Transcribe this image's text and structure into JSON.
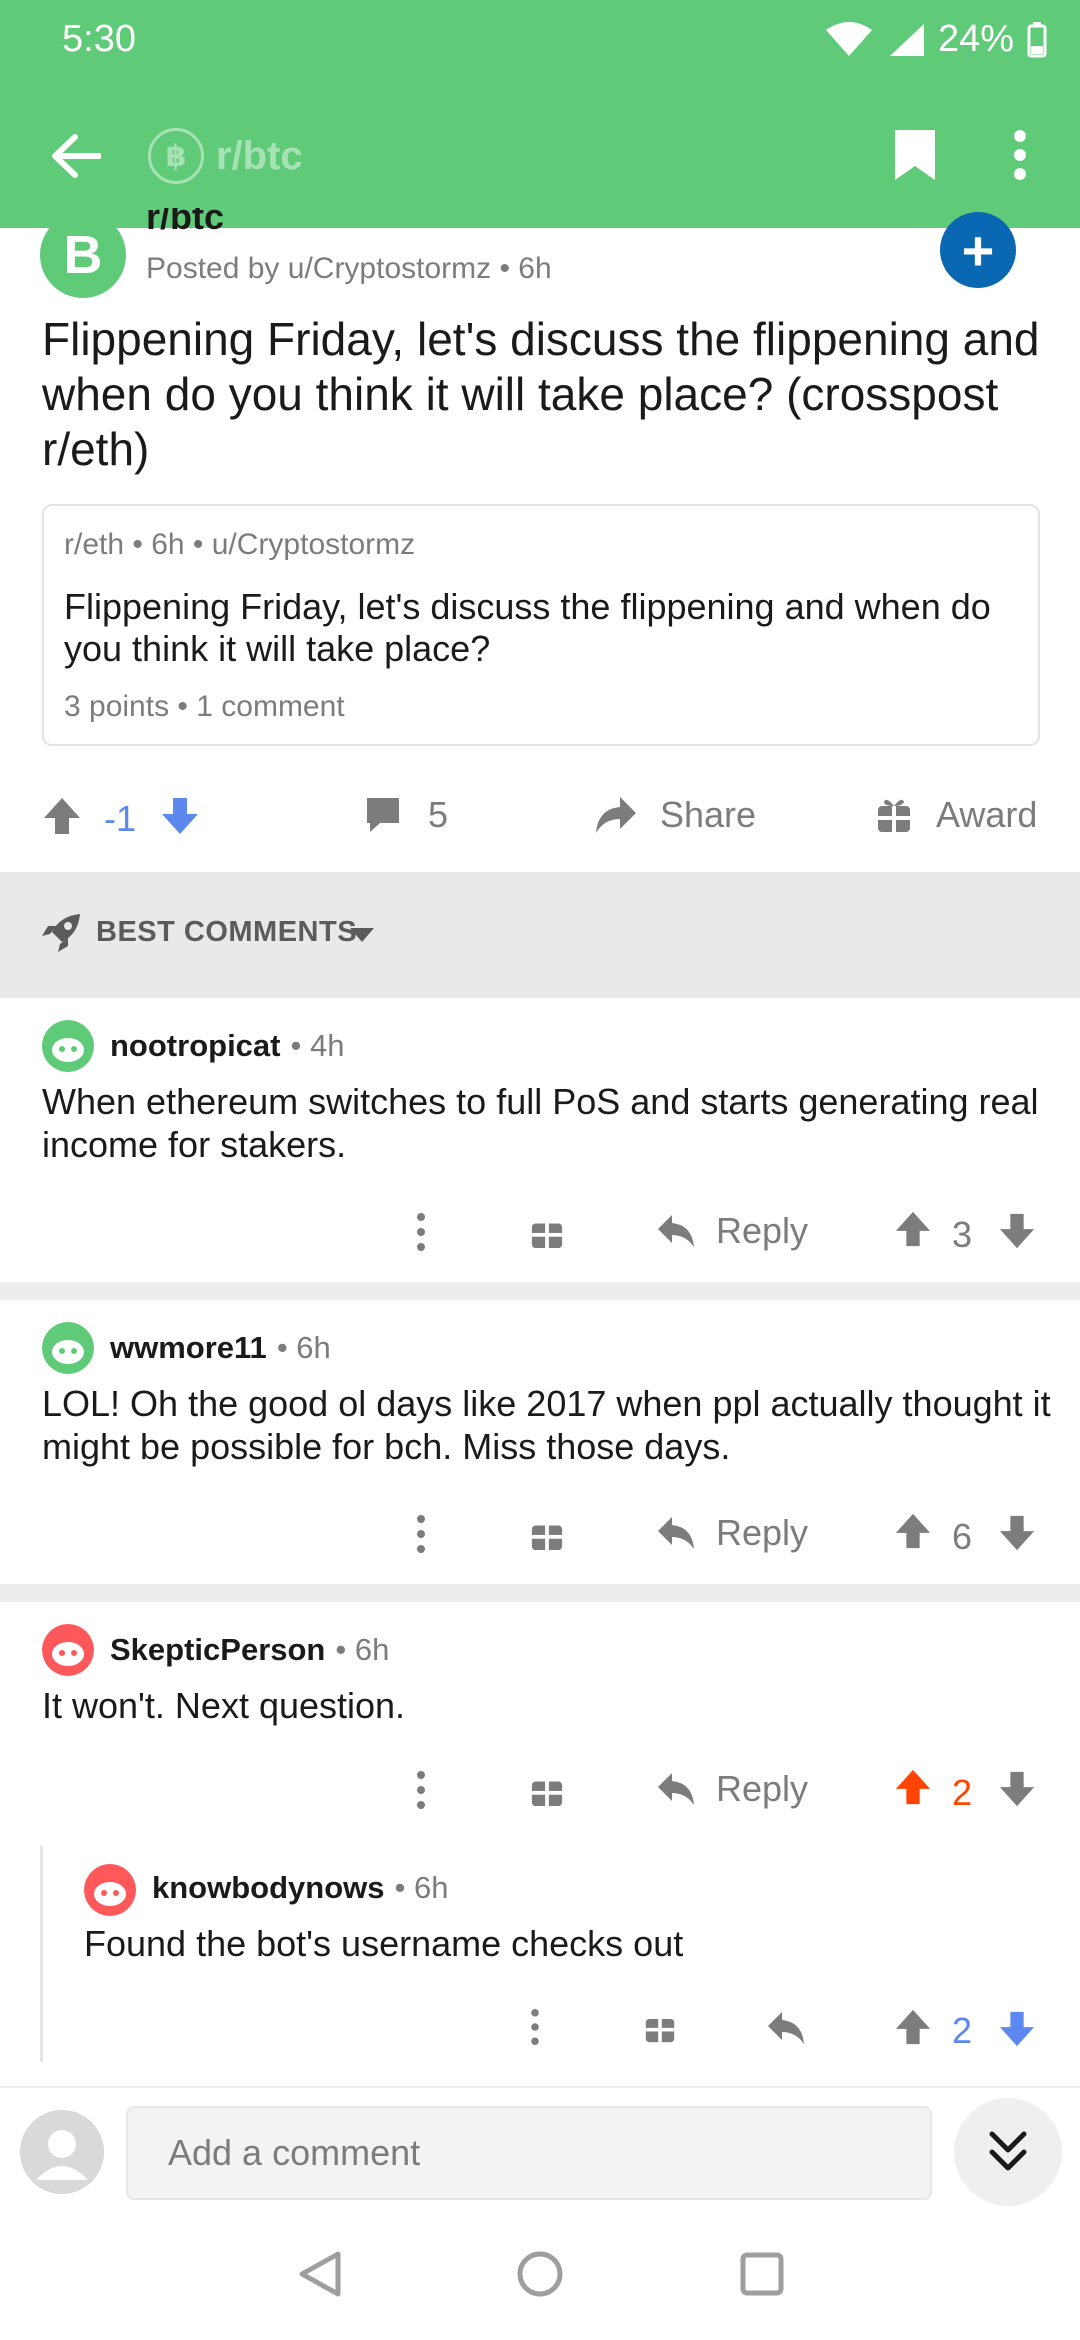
{
  "status": {
    "time": "5:30",
    "battery": "24%"
  },
  "appbar": {
    "subreddit": "r/btc",
    "coin_glyph": "฿"
  },
  "post": {
    "subreddit_avatar_glyph": "B",
    "subreddit": "r/btc",
    "posted_by": "Posted by u/Cryptostormz • 6h",
    "title": "Flippening Friday, let's discuss the flippening and when do you think it will take place? (crosspost r/eth)",
    "crosspost": {
      "meta": "r/eth • 6h • u/Cryptostormz",
      "title": "Flippening Friday, let's discuss the flippening and when do you think it will take place?",
      "stats": "3 points • 1 comment"
    },
    "score": "-1",
    "comments_count": "5",
    "share_label": "Share",
    "award_label": "Award",
    "accent_down": "#5c88f0"
  },
  "sort": {
    "label": "BEST COMMENTS"
  },
  "comments": [
    {
      "author": "nootropicat",
      "time": "• 4h",
      "body": "When ethereum switches to full PoS and starts generating real income for stakers.",
      "reply": "Reply",
      "score": "3"
    },
    {
      "author": "wwmore11",
      "time": "• 6h",
      "body": "LOL! Oh the good ol days like 2017 when ppl actually thought it might be possible for bch. Miss those days.",
      "reply": "Reply",
      "score": "6"
    },
    {
      "author": "SkepticPerson",
      "time": "• 6h",
      "body": "It won't. Next question.",
      "reply": "Reply",
      "score": "2"
    },
    {
      "author": "knowbodynows",
      "time": "• 6h",
      "body": "Found the bot's username checks out",
      "score": "2"
    }
  ],
  "composer": {
    "placeholder": "Add a comment"
  },
  "colors": {
    "brand_green": "#5fcb78",
    "upvote_orange": "#ff4500",
    "downvote_blue": "#5c88f0"
  }
}
